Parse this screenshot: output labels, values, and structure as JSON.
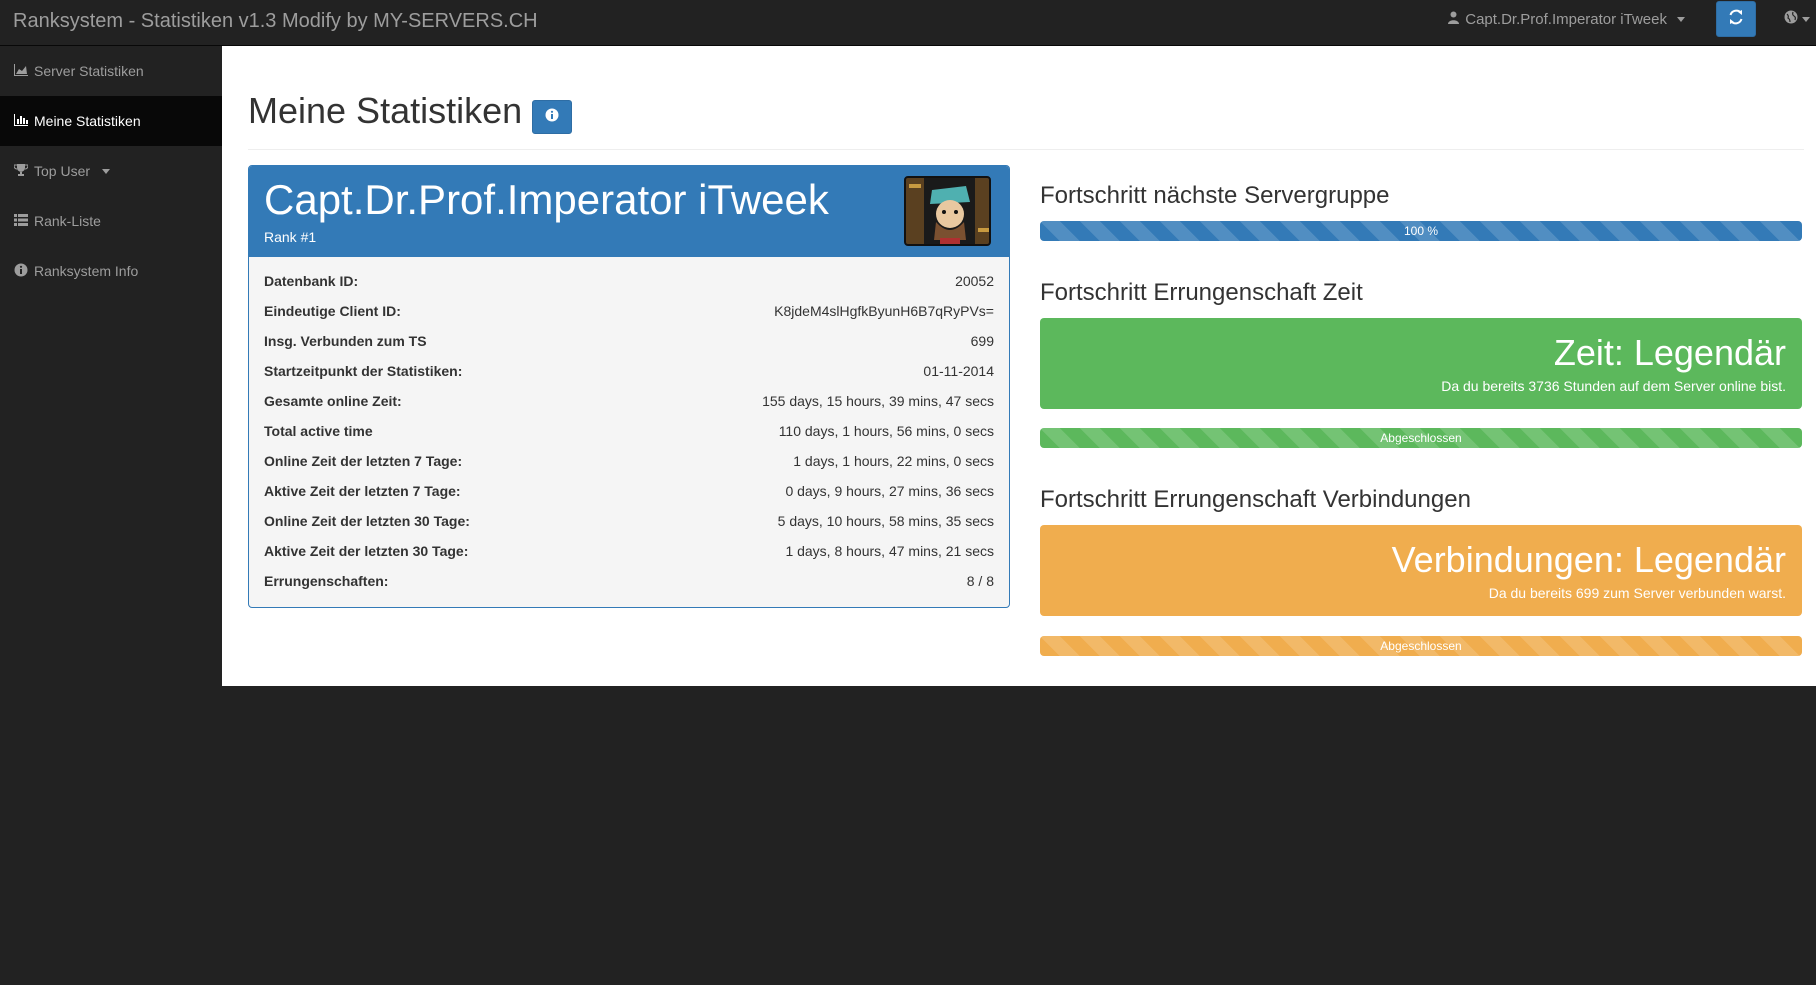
{
  "navbar": {
    "brand": "Ranksystem - Statistiken v1.3 Modify by MY-SERVERS.CH",
    "user_name": "Capt.Dr.Prof.Imperator iTweek",
    "refresh_icon": "refresh-icon",
    "globe_icon": "globe-icon"
  },
  "sidebar": {
    "items": [
      {
        "label": "Server Statistiken",
        "icon": "area-chart-icon"
      },
      {
        "label": "Meine Statistiken",
        "icon": "bar-chart-icon",
        "active": true
      },
      {
        "label": "Top User",
        "icon": "trophy-icon"
      },
      {
        "label": "Rank-Liste",
        "icon": "list-icon"
      },
      {
        "label": "Ranksystem Info",
        "icon": "info-circle-icon"
      }
    ]
  },
  "main": {
    "title": "Meine Statistiken",
    "info_icon": "info-icon"
  },
  "profile": {
    "name": "Capt.Dr.Prof.Imperator iTweek",
    "rank": "Rank #1",
    "stats": [
      {
        "label": "Datenbank ID:",
        "value": "20052"
      },
      {
        "label": "Eindeutige Client ID:",
        "value": "K8jdeM4slHgfkByunH6B7qRyPVs="
      },
      {
        "label": "Insg. Verbunden zum TS",
        "value": "699"
      },
      {
        "label": "Startzeitpunkt der Statistiken:",
        "value": "01-11-2014"
      },
      {
        "label": "Gesamte online Zeit:",
        "value": "155 days, 15 hours, 39 mins, 47 secs"
      },
      {
        "label": "Total active time",
        "value": "110 days, 1 hours, 56 mins, 0 secs"
      },
      {
        "label": "Online Zeit der letzten 7 Tage:",
        "value": "1 days, 1 hours, 22 mins, 0 secs"
      },
      {
        "label": "Aktive Zeit der letzten 7 Tage:",
        "value": "0 days, 9 hours, 27 mins, 36 secs"
      },
      {
        "label": "Online Zeit der letzten 30 Tage:",
        "value": "5 days, 10 hours, 58 mins, 35 secs"
      },
      {
        "label": "Aktive Zeit der letzten 30 Tage:",
        "value": "1 days, 8 hours, 47 mins, 21 secs"
      },
      {
        "label": "Errungenschaften:",
        "value": "8 / 8"
      }
    ]
  },
  "progress": {
    "servergroup": {
      "title": "Fortschritt nächste Servergruppe",
      "bar_label": "100 %",
      "value_percent": 100,
      "color": "#337ab7"
    },
    "time": {
      "title": "Fortschritt Errungenschaft Zeit",
      "achievement": "Zeit: Legendär",
      "description": "Da du bereits 3736 Stunden auf dem Server online bist.",
      "bar_label": "Abgeschlossen",
      "value_percent": 100,
      "color": "#5cb85c"
    },
    "connections": {
      "title": "Fortschritt Errungenschaft Verbindungen",
      "achievement": "Verbindungen: Legendär",
      "description": "Da du bereits 699 zum Server verbunden warst.",
      "bar_label": "Abgeschlossen",
      "value_percent": 100,
      "color": "#f0ad4e"
    }
  }
}
